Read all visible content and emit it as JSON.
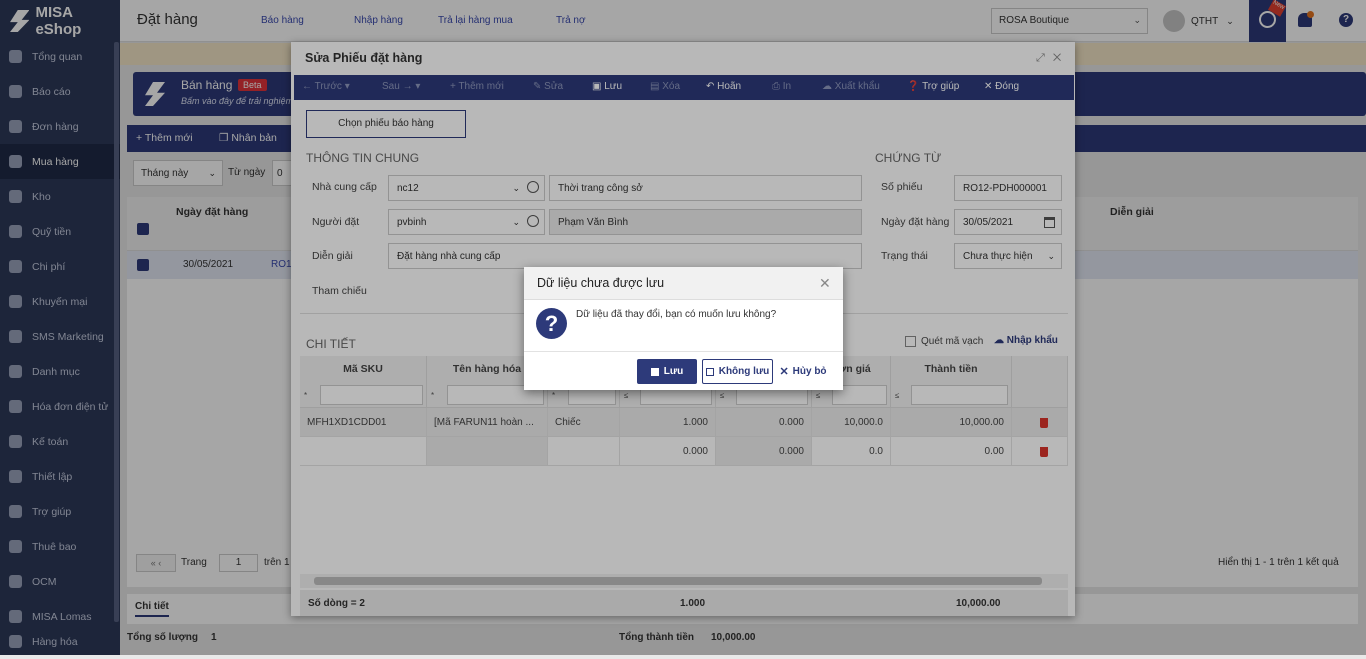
{
  "app": {
    "logo_text": "MISA eShop"
  },
  "sidebar": {
    "items": [
      {
        "label": "Tổng quan"
      },
      {
        "label": "Báo cáo"
      },
      {
        "label": "Đơn hàng"
      },
      {
        "label": "Mua hàng"
      },
      {
        "label": "Kho"
      },
      {
        "label": "Quỹ tiền"
      },
      {
        "label": "Chi phí"
      },
      {
        "label": "Khuyến mại"
      },
      {
        "label": "SMS Marketing"
      },
      {
        "label": "Danh mục"
      },
      {
        "label": "Hóa đơn điện tử"
      },
      {
        "label": "Kế toán"
      },
      {
        "label": "Thiết lập"
      },
      {
        "label": "Trợ giúp"
      },
      {
        "label": "Thuê bao"
      },
      {
        "label": "OCM"
      },
      {
        "label": "MISA Lomas"
      },
      {
        "label": "Hàng hóa"
      }
    ]
  },
  "header": {
    "title": "Đặt hàng",
    "links": [
      "Báo hàng",
      "Nhập hàng",
      "Trả lại hàng mua",
      "Trả nợ"
    ],
    "store": "ROSA Boutique",
    "user": "QTHT",
    "badge": "New"
  },
  "banner": {
    "title": "Bán hàng",
    "beta": "Beta",
    "subtitle": "Bấm vào đây để trải nghiệm"
  },
  "list": {
    "toolbar": {
      "add": "Thêm mới",
      "duplicate": "Nhân bản"
    },
    "filter": {
      "period": "Tháng này",
      "from_label": "Từ ngày",
      "from_value": "0"
    },
    "columns": {
      "date": "Ngày đặt hàng",
      "desc": "Diễn giải"
    },
    "row": {
      "date": "30/05/2021",
      "code": "RO1"
    },
    "pager": {
      "page_label": "Trang",
      "page": "1",
      "of": "trên 1",
      "summary": "Hiển thị 1 - 1 trên 1 kết quả"
    },
    "detail_tab": "Chi tiết",
    "footer": {
      "qty_label": "Tổng số lượng",
      "qty": "1",
      "total_label": "Tổng thành tiền",
      "total": "10,000.00"
    }
  },
  "edit": {
    "title": "Sửa Phiếu đặt hàng",
    "toolbar": {
      "prev": "Trước",
      "next": "Sau",
      "add": "Thêm mới",
      "edit": "Sửa",
      "save": "Lưu",
      "delete": "Xóa",
      "undo": "Hoãn",
      "print": "In",
      "export": "Xuất khẩu",
      "help": "Trợ giúp",
      "close": "Đóng"
    },
    "choose_btn": "Chọn phiếu báo hàng",
    "general": {
      "heading": "THÔNG TIN CHUNG",
      "supplier_label": "Nhà cung cấp",
      "supplier_code": "nc12",
      "supplier_name": "Thời trang công sở",
      "orderer_label": "Người đặt",
      "orderer_code": "pvbinh",
      "orderer_name": "Phạm Văn Bình",
      "desc_label": "Diễn giải",
      "desc": "Đặt hàng nhà cung cấp",
      "ref_label": "Tham chiếu"
    },
    "voucher": {
      "heading": "CHỨNG TỪ",
      "no_label": "Số phiếu",
      "no": "RO12-PDH000001",
      "date_label": "Ngày đặt hàng",
      "date": "30/05/2021",
      "status_label": "Trạng thái",
      "status": "Chưa thực hiện"
    },
    "detail": {
      "heading": "CHI TIẾT",
      "scan": "Quét mã vạch",
      "import": "Nhập khẩu",
      "columns": [
        "Mã SKU",
        "Tên hàng hóa",
        "",
        "",
        "",
        "Đơn giá",
        "Thành tiền"
      ],
      "filter_ops": [
        "*",
        "*",
        "*",
        "≤",
        "≤",
        "≤",
        "≤"
      ],
      "rows": [
        {
          "sku": "MFH1XD1CDD01",
          "name": "[Mã FARUN11 hoàn ...",
          "unit": "Chiếc",
          "qty": "1.000",
          "c5": "0.000",
          "price": "10,000.0",
          "amount": "10,000.00"
        },
        {
          "sku": "",
          "name": "",
          "unit": "",
          "qty": "0.000",
          "c5": "0.000",
          "price": "0.0",
          "amount": "0.00"
        }
      ],
      "summary": {
        "count": "Số dòng = 2",
        "qty": "1.000",
        "amount": "10,000.00"
      }
    }
  },
  "confirm": {
    "title": "Dữ liệu chưa được lưu",
    "message": "Dữ liệu đã thay đổi, bạn có muốn lưu không?",
    "save": "Lưu",
    "nosave": "Không lưu",
    "cancel": "Hủy bỏ"
  }
}
